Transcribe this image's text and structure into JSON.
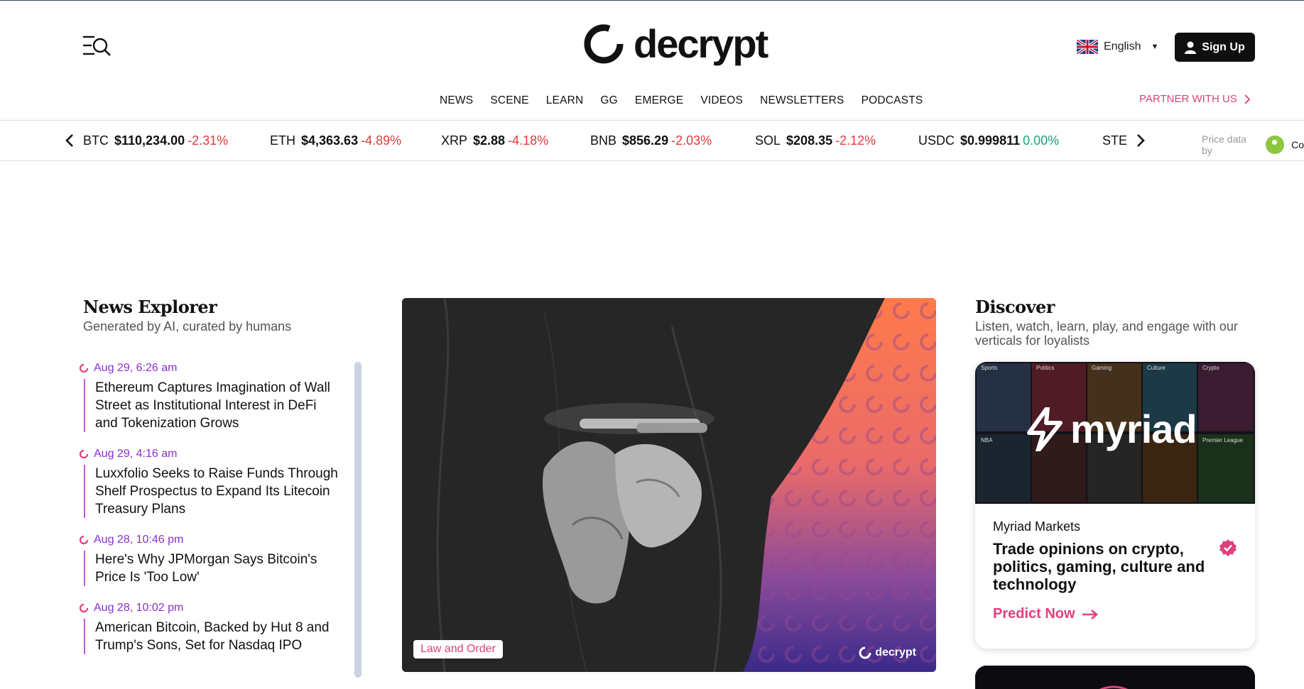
{
  "header": {
    "brand": "decrypt",
    "language": "English",
    "signup_label": "Sign Up",
    "partner_label": "PARTNER WITH US"
  },
  "nav": [
    "NEWS",
    "SCENE",
    "LEARN",
    "GG",
    "EMERGE",
    "VIDEOS",
    "NEWSLETTERS",
    "PODCASTS"
  ],
  "ticker": {
    "items": [
      {
        "symbol": "BTC",
        "price": "$110,234.00",
        "change": "-2.31%",
        "dir": "neg"
      },
      {
        "symbol": "ETH",
        "price": "$4,363.63",
        "change": "-4.89%",
        "dir": "neg"
      },
      {
        "symbol": "XRP",
        "price": "$2.88",
        "change": "-4.18%",
        "dir": "neg"
      },
      {
        "symbol": "BNB",
        "price": "$856.29",
        "change": "-2.03%",
        "dir": "neg"
      },
      {
        "symbol": "SOL",
        "price": "$208.35",
        "change": "-2.12%",
        "dir": "neg"
      },
      {
        "symbol": "USDC",
        "price": "$0.999811",
        "change": "0.00%",
        "dir": "pos"
      },
      {
        "symbol": "STETH",
        "price": "",
        "change": "",
        "dir": "neg"
      }
    ],
    "price_data_label": "Price data by",
    "provider_label": "Co"
  },
  "news_explorer": {
    "title": "News Explorer",
    "subtitle": "Generated by AI, curated by humans",
    "items": [
      {
        "time": "Aug 29, 6:26 am",
        "headline": "Ethereum Captures Imagination of Wall Street as Institutional Interest in DeFi and Tokenization Grows"
      },
      {
        "time": "Aug 29, 4:16 am",
        "headline": "Luxxfolio Seeks to Raise Funds Through Shelf Prospectus to Expand Its Litecoin Treasury Plans"
      },
      {
        "time": "Aug 28, 10:46 pm",
        "headline": "Here's Why JPMorgan Says Bitcoin's Price Is 'Too Low'"
      },
      {
        "time": "Aug 28, 10:02 pm",
        "headline": "American Bitcoin, Backed by Hut 8 and Trump's Sons, Set for Nasdaq IPO"
      }
    ]
  },
  "hero": {
    "category": "Law and Order",
    "watermark": "decrypt"
  },
  "discover": {
    "title": "Discover",
    "subtitle": "Listen, watch, learn, play, and engage with our verticals for loyalists",
    "card": {
      "brand": "myriad",
      "tiles": [
        "Sports",
        "Politics",
        "Gaming",
        "Culture",
        "Crypto",
        "NBA",
        "",
        "",
        "",
        "Premier League"
      ],
      "kicker": "Myriad Markets",
      "headline": "Trade opinions on crypto, politics, gaming, culture and technology",
      "cta": "Predict Now"
    }
  },
  "colors": {
    "accent": "#e0407d",
    "time": "#8a2fd0",
    "negative": "#e23a3a",
    "positive": "#16a37a"
  }
}
